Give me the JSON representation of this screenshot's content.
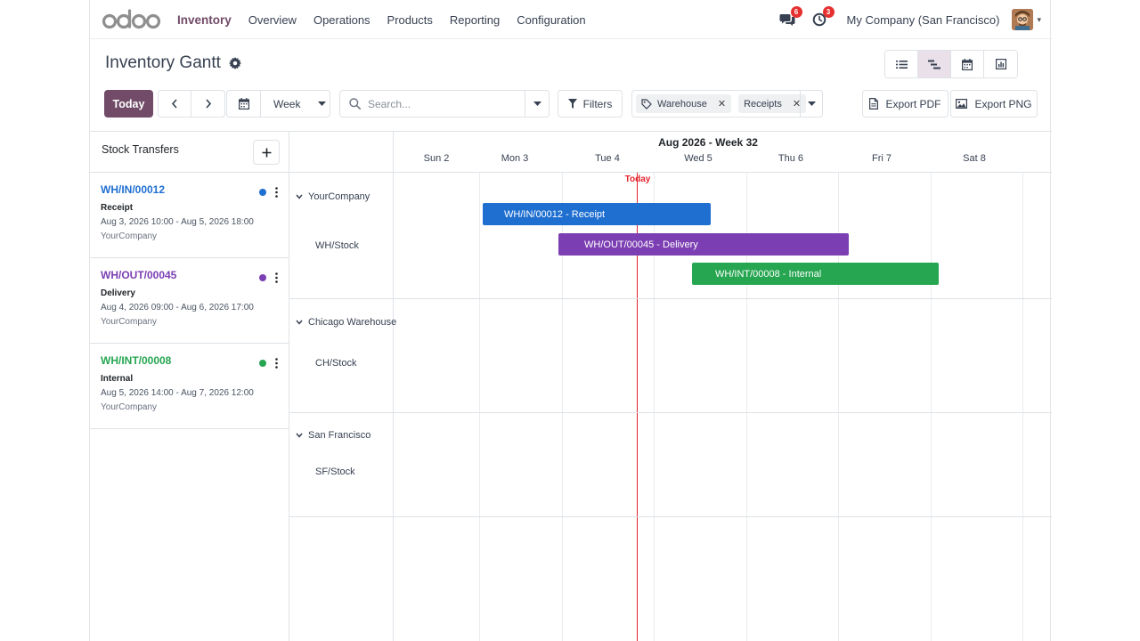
{
  "nav": {
    "brand": "Inventory",
    "menu": [
      "Overview",
      "Operations",
      "Products",
      "Reporting",
      "Configuration"
    ],
    "messages_count": "6",
    "activities_count": "3",
    "company": "My Company (San Francisco)"
  },
  "page": {
    "title": "Inventory Gantt"
  },
  "toolbar": {
    "today_label": "Today",
    "scale_label": "Week",
    "search_placeholder": "Search...",
    "filters_label": "Filters",
    "facets": [
      "Warehouse",
      "Receipts"
    ],
    "export_pdf": "Export PDF",
    "export_png": "Export PNG"
  },
  "views": [
    "list-icon",
    "gantt-icon",
    "calendar-icon",
    "graph-icon"
  ],
  "active_view": "gantt-icon",
  "sidebar": {
    "title": "Stock Transfers",
    "cards": [
      {
        "ref": "WH/IN/00012",
        "type": "Receipt",
        "dates": "Aug 3, 2026 10:00 - Aug 5, 2026 18:00",
        "company": "YourCompany",
        "color": "#1f6fd1"
      },
      {
        "ref": "WH/OUT/00045",
        "type": "Delivery",
        "dates": "Aug 4, 2026 09:00 - Aug 6, 2026 17:00",
        "company": "YourCompany",
        "color": "#7b3fb3"
      },
      {
        "ref": "WH/INT/00008",
        "type": "Internal",
        "dates": "Aug 5, 2026 14:00 - Aug 7, 2026 12:00",
        "company": "YourCompany",
        "color": "#26a651"
      }
    ]
  },
  "gantt": {
    "period_title": "Aug 2026 - Week 32",
    "days": [
      "Sun 2",
      "Mon 3",
      "Tue 4",
      "Wed 5",
      "Thu 6",
      "Fri 7",
      "Sat 8"
    ],
    "today_label": "Today",
    "groups": [
      {
        "name": "YourCompany",
        "location": "WH/Stock"
      },
      {
        "name": "Chicago Warehouse",
        "location": "CH/Stock"
      },
      {
        "name": "San Francisco",
        "location": "SF/Stock"
      }
    ],
    "pills": [
      {
        "label": "WH/IN/00012 - Receipt",
        "color": "#1f6fd1"
      },
      {
        "label": "WH/OUT/00045 - Delivery",
        "color": "#7b3fb3"
      },
      {
        "label": "WH/INT/00008 - Internal",
        "color": "#26a651"
      }
    ]
  }
}
